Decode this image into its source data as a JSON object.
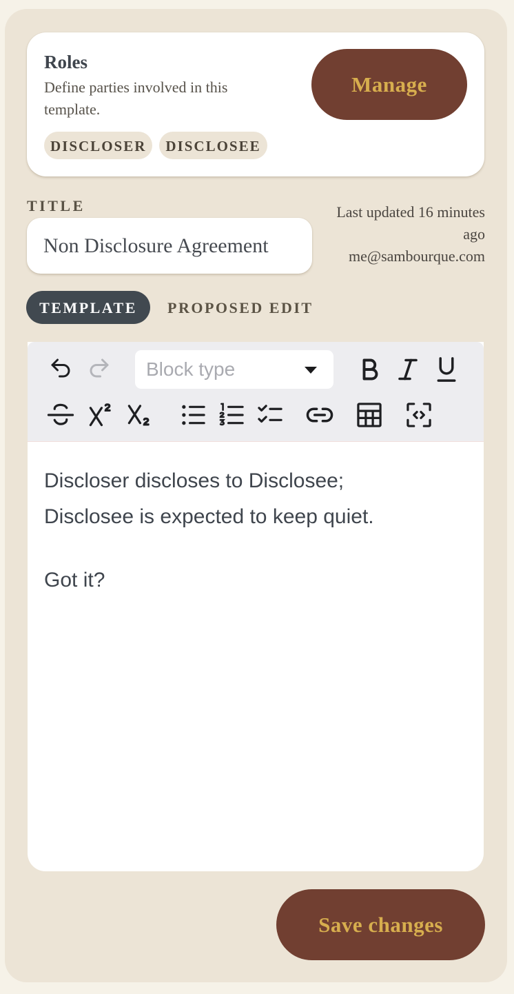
{
  "roles": {
    "title": "Roles",
    "description": "Define parties involved in this template.",
    "chips": [
      "DISCLOSER",
      "DISCLOSEE"
    ],
    "manage_label": "Manage"
  },
  "title_field": {
    "label": "TITLE",
    "value": "Non Disclosure Agreement"
  },
  "meta": {
    "updated": "Last updated 16 minutes ago",
    "author": "me@sambourque.com"
  },
  "tabs": [
    {
      "label": "TEMPLATE",
      "active": true
    },
    {
      "label": "PROPOSED EDIT",
      "active": false
    }
  ],
  "toolbar": {
    "block_type_placeholder": "Block type",
    "icons": [
      "undo-icon",
      "redo-icon",
      "bold-icon",
      "italic-icon",
      "underline-icon",
      "strikethrough-icon",
      "superscript-icon",
      "subscript-icon",
      "bulleted-list-icon",
      "numbered-list-icon",
      "checklist-icon",
      "link-icon",
      "table-icon",
      "code-block-icon"
    ]
  },
  "editor": {
    "line1": "Discloser discloses to Disclosee;",
    "line2": "Disclosee is expected to keep quiet.",
    "line3": "Got it?"
  },
  "save_label": "Save changes",
  "colors": {
    "background": "#ece4d6",
    "accent_button": "#713f31",
    "accent_text": "#d7ae4e",
    "active_tab": "#414950"
  }
}
